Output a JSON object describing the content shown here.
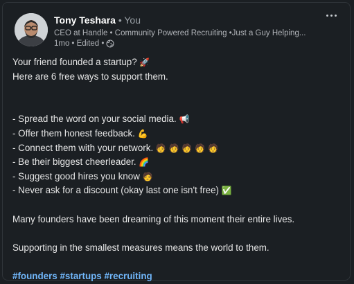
{
  "author": {
    "name": "Tony Teshara",
    "tag": " • You",
    "headline": "CEO at Handle • Community Powered Recruiting •Just a Guy Helping...",
    "time": "1mo",
    "edited": "• Edited •",
    "visibility_icon": "globe-icon"
  },
  "menu": {
    "icon": "more-horizontal-icon"
  },
  "post": {
    "intro_1": "Your friend founded a startup?",
    "intro_1_emoji": "🚀",
    "intro_2": "Here are 6 free ways to support them.",
    "list": [
      {
        "text": "- Spread the word on your social media.",
        "emoji": "📢"
      },
      {
        "text": "- Offer them honest feedback.",
        "emoji": "💪"
      },
      {
        "text": "- Connect them with your network.",
        "emoji": "🧑 🧑  🧑 🧑 🧑"
      },
      {
        "text": "- Be their biggest cheerleader.",
        "emoji": "🌈"
      },
      {
        "text": "- Suggest good hires you know",
        "emoji": "🧑"
      },
      {
        "text": "- Never ask for a discount (okay last one isn't free)",
        "emoji": "✅"
      }
    ],
    "para_1": "Many founders have been dreaming of this moment their entire lives.",
    "para_2": "Supporting in the smallest measures means the world to them.",
    "hashtags": [
      "#founders",
      "#startups",
      "#recruiting"
    ]
  }
}
